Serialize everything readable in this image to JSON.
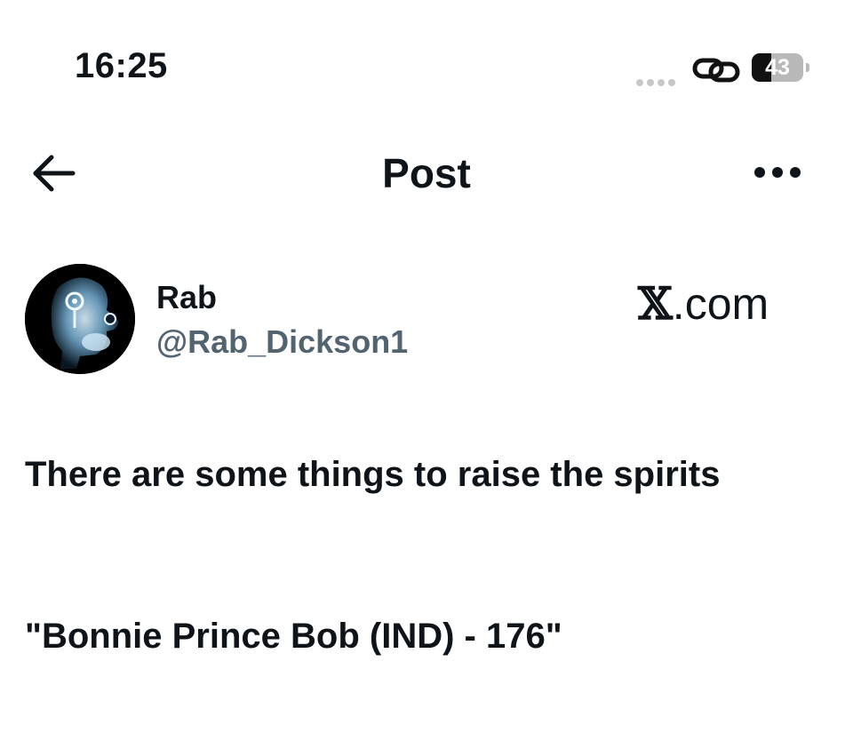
{
  "status_bar": {
    "time": "16:25",
    "battery": "43",
    "icons": [
      "signal-dots-icon",
      "link-icon",
      "battery-icon"
    ]
  },
  "header": {
    "title": "Post",
    "back_icon": "arrow-left-icon",
    "more_icon": "more-horizontal-icon"
  },
  "author": {
    "name": "Rab",
    "handle": "@Rab_Dickson1",
    "avatar_icon": "xray-head-avatar"
  },
  "watermark": {
    "x": "𝕏",
    "domain": ".com"
  },
  "post": {
    "line1": "There are some things to raise the spirits",
    "line2": "\"Bonnie Prince Bob (IND) - 176\""
  }
}
